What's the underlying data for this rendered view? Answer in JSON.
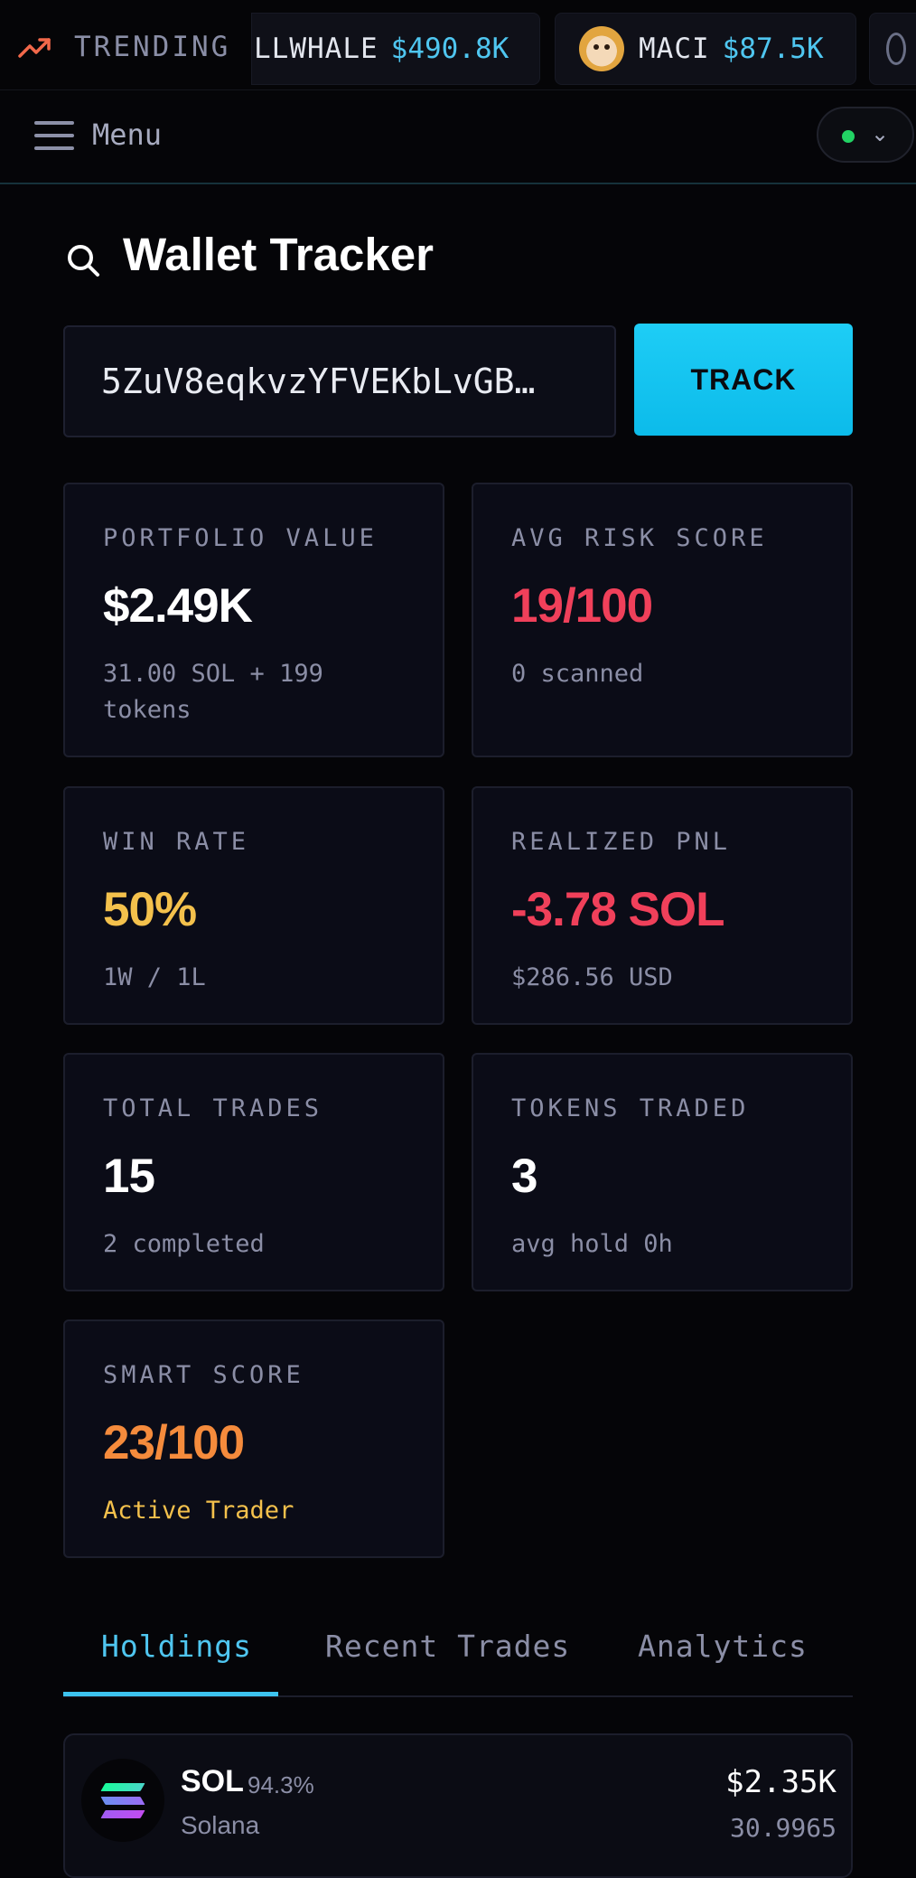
{
  "ticker": {
    "label": "TRENDING",
    "items": [
      {
        "name": "LLWHALE",
        "value": "$490.8K"
      },
      {
        "name": "MACI",
        "value": "$87.5K"
      }
    ]
  },
  "header": {
    "menu_label": "Menu",
    "network_status_color": "#22d364"
  },
  "page": {
    "title": "Wallet Tracker"
  },
  "search": {
    "address_value": "5ZuV8eqkvzYFVEKbLvGB…",
    "track_label": "TRACK"
  },
  "stats": {
    "portfolio": {
      "label": "PORTFOLIO VALUE",
      "value": "$2.49K",
      "sub": "31.00 SOL + 199 tokens"
    },
    "risk": {
      "label": "AVG RISK SCORE",
      "value": "19/100",
      "sub": "0 scanned"
    },
    "winrate": {
      "label": "WIN RATE",
      "value": "50%",
      "sub": "1W / 1L"
    },
    "pnl": {
      "label": "REALIZED PNL",
      "value": "-3.78 SOL",
      "sub": "$286.56 USD"
    },
    "trades": {
      "label": "TOTAL TRADES",
      "value": "15",
      "sub": "2 completed"
    },
    "tokens": {
      "label": "TOKENS TRADED",
      "value": "3",
      "sub": "avg hold 0h"
    },
    "smart": {
      "label": "SMART SCORE",
      "value": "23/100",
      "sub": "Active Trader"
    }
  },
  "colors": {
    "accent": "#4fc6f0",
    "danger": "#f0405a",
    "warning": "#f4c14c",
    "orange": "#f58b3c"
  },
  "tabs": [
    "Holdings",
    "Recent Trades",
    "Analytics"
  ],
  "holdings": [
    {
      "symbol": "SOL",
      "percent": "94.3%",
      "name": "Solana",
      "usd": "$2.35K",
      "amount": "30.9965"
    }
  ]
}
